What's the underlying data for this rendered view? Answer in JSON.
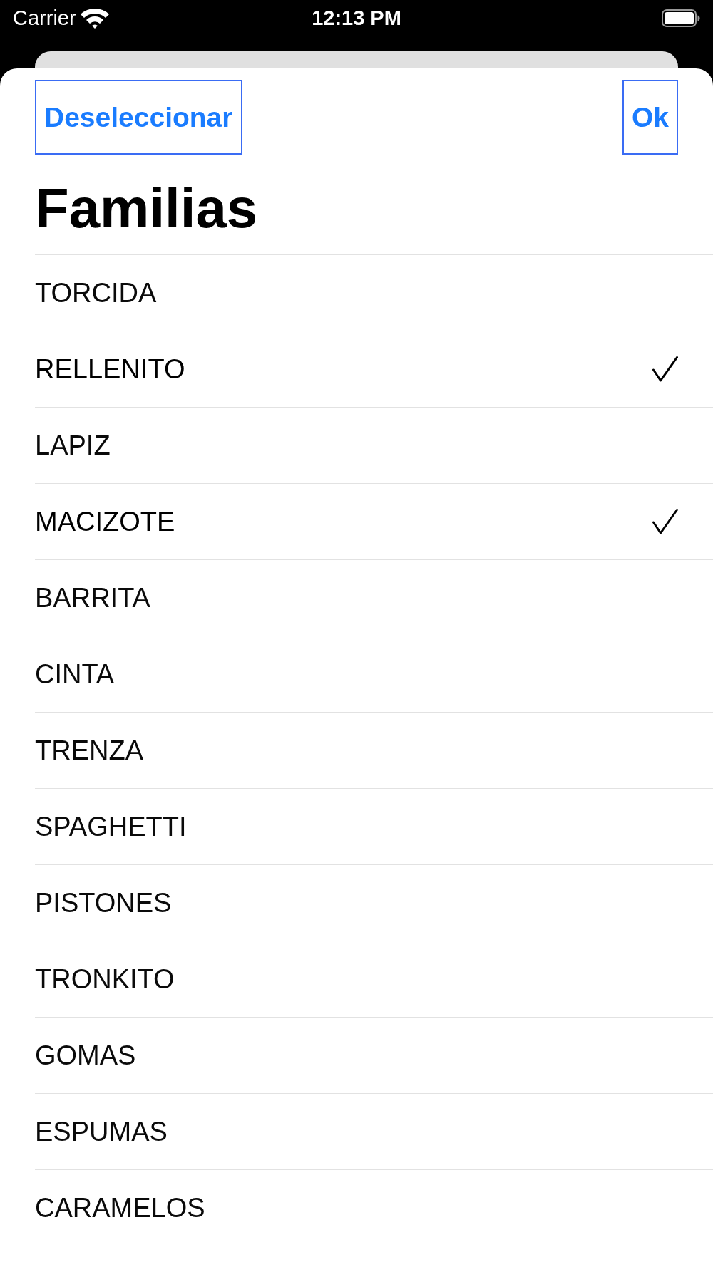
{
  "status_bar": {
    "carrier": "Carrier",
    "time": "12:13 PM"
  },
  "sheet": {
    "buttons": [
      {
        "label": "Deseleccionar"
      },
      {
        "label": "Ok"
      }
    ],
    "title": "Familias",
    "items": [
      {
        "label": "TORCIDA",
        "checked": false
      },
      {
        "label": "RELLENITO",
        "checked": true
      },
      {
        "label": "LAPIZ",
        "checked": false
      },
      {
        "label": "MACIZOTE",
        "checked": true
      },
      {
        "label": "BARRITA",
        "checked": false
      },
      {
        "label": "CINTA",
        "checked": false
      },
      {
        "label": "TRENZA",
        "checked": false
      },
      {
        "label": "SPAGHETTI",
        "checked": false
      },
      {
        "label": "PISTONES",
        "checked": false
      },
      {
        "label": "TRONKITO",
        "checked": false
      },
      {
        "label": "GOMAS",
        "checked": false
      },
      {
        "label": "ESPUMAS",
        "checked": false
      },
      {
        "label": "CARAMELOS",
        "checked": false
      }
    ]
  }
}
